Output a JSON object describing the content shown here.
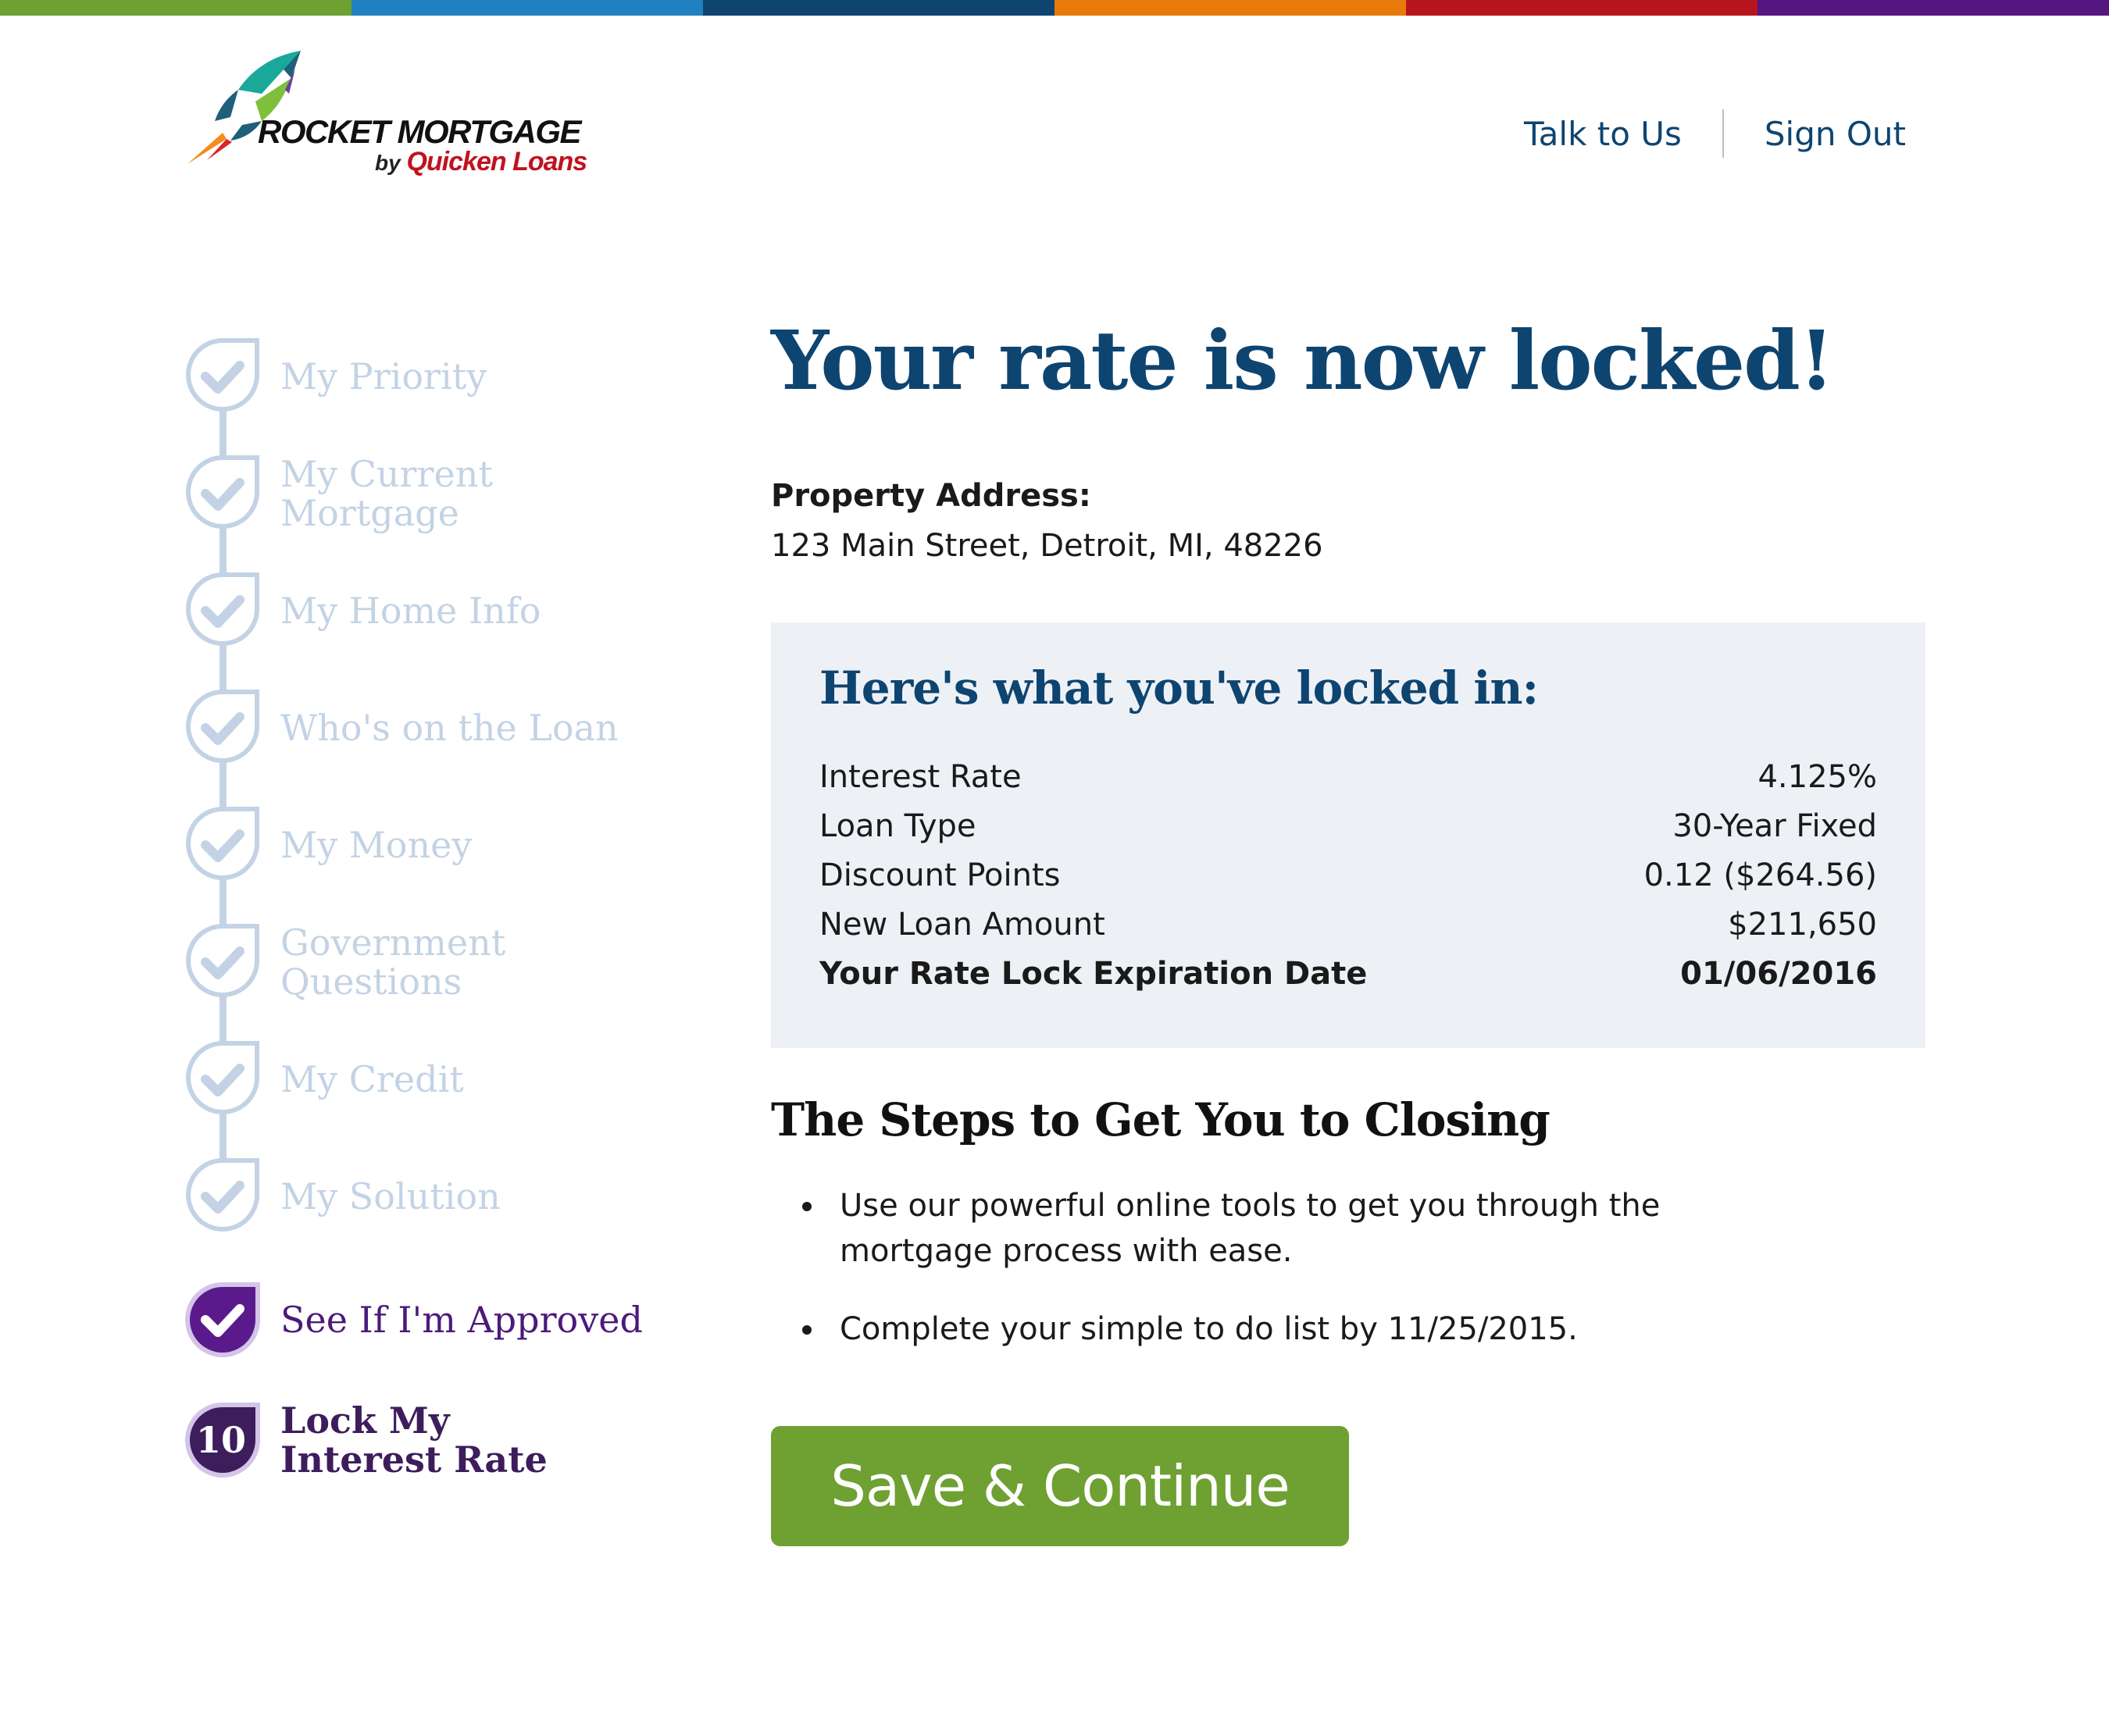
{
  "brand": {
    "name": "ROCKET MORTGAGE",
    "by": "by",
    "company": "Quicken Loans",
    "topbar_colors": [
      "#6ea032",
      "#2180bf",
      "#0e4470",
      "#e87a0a",
      "#b8141e",
      "#55167f"
    ]
  },
  "header": {
    "links": [
      {
        "label": "Talk to Us"
      },
      {
        "label": "Sign Out"
      }
    ]
  },
  "sidebar": {
    "steps": [
      {
        "label": "My Priority",
        "status": "complete",
        "icon": "check-icon"
      },
      {
        "label": "My Current Mortgage",
        "status": "complete",
        "icon": "check-icon"
      },
      {
        "label": "My Home Info",
        "status": "complete",
        "icon": "check-icon"
      },
      {
        "label": "Who's on the Loan",
        "status": "complete",
        "icon": "check-icon"
      },
      {
        "label": "My Money",
        "status": "complete",
        "icon": "check-icon"
      },
      {
        "label": "Government Questions",
        "status": "complete",
        "icon": "check-icon"
      },
      {
        "label": "My Credit",
        "status": "complete",
        "icon": "check-icon"
      },
      {
        "label": "My Solution",
        "status": "complete",
        "icon": "check-icon"
      },
      {
        "label": "See If I'm Approved",
        "status": "complete-highlight",
        "icon": "check-icon"
      },
      {
        "label": "Lock My Interest Rate",
        "status": "active",
        "number": "10"
      }
    ]
  },
  "main": {
    "title": "Your rate is now locked!",
    "property_label": "Property Address:",
    "property_value": "123 Main Street, Detroit, MI, 48226",
    "summary": {
      "heading": "Here's what you've locked in:",
      "rows": [
        {
          "label": "Interest Rate",
          "value": "4.125%"
        },
        {
          "label": "Loan Type",
          "value": "30-Year Fixed"
        },
        {
          "label": "Discount Points",
          "value": "0.12 ($264.56)"
        },
        {
          "label": "New Loan Amount",
          "value": "$211,650"
        },
        {
          "label": "Your Rate Lock Expiration Date",
          "value": "01/06/2016"
        }
      ]
    },
    "closing": {
      "heading": "The Steps to Get You to Closing",
      "items": [
        "Use our powerful online tools to get you through the mortgage process with ease.",
        "Complete your simple to do list by 11/25/2015."
      ]
    },
    "save_label": "Save & Continue"
  }
}
